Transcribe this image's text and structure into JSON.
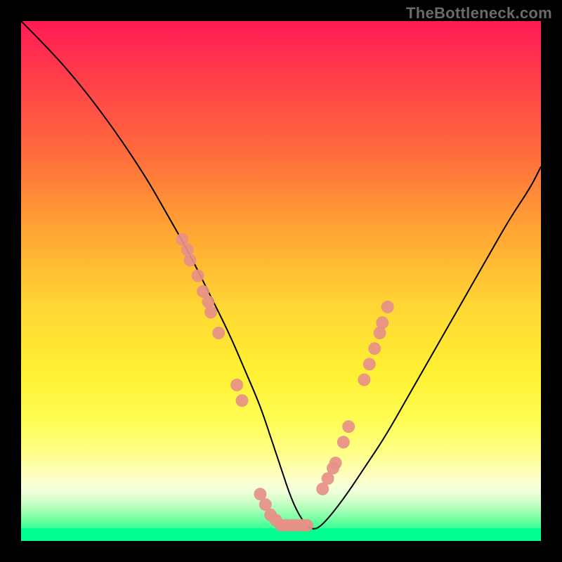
{
  "watermark": "TheBottleneck.com",
  "chart_data": {
    "type": "line",
    "title": "",
    "xlabel": "",
    "ylabel": "",
    "xlim": [
      0,
      100
    ],
    "ylim": [
      0,
      100
    ],
    "grid": false,
    "legend_position": "none",
    "curve": {
      "x": [
        0,
        6,
        12,
        18,
        24,
        28,
        32,
        36,
        40,
        43,
        46,
        48,
        50,
        52,
        54,
        56,
        58,
        62,
        66,
        70,
        74,
        78,
        82,
        86,
        90,
        94,
        98,
        100
      ],
      "y": [
        100,
        94,
        87,
        79,
        70,
        63,
        56,
        48,
        40,
        33,
        26,
        20,
        14,
        8,
        4,
        2,
        3,
        8,
        14,
        20,
        27,
        34,
        41,
        48,
        55,
        62,
        68,
        72
      ]
    },
    "markers": {
      "color": "#e79088",
      "radius_px": 9,
      "points_xy": [
        [
          31,
          58
        ],
        [
          32,
          56
        ],
        [
          32.5,
          54
        ],
        [
          34,
          51
        ],
        [
          35,
          48
        ],
        [
          36,
          46
        ],
        [
          36.5,
          44
        ],
        [
          38,
          40
        ],
        [
          41.5,
          30
        ],
        [
          42.5,
          27
        ],
        [
          46,
          9
        ],
        [
          47,
          7
        ],
        [
          48,
          5
        ],
        [
          49,
          4
        ],
        [
          50,
          3
        ],
        [
          51,
          3
        ],
        [
          52,
          3
        ],
        [
          53,
          3
        ],
        [
          54,
          3
        ],
        [
          55,
          3
        ],
        [
          58,
          10
        ],
        [
          59,
          12
        ],
        [
          60,
          14
        ],
        [
          60.5,
          15
        ],
        [
          62,
          19
        ],
        [
          63,
          22
        ],
        [
          66,
          31
        ],
        [
          67,
          34
        ],
        [
          68,
          37
        ],
        [
          69,
          40
        ],
        [
          69.5,
          42
        ],
        [
          70.5,
          45
        ]
      ]
    },
    "background_gradient": {
      "top_color": "#ff1a55",
      "mid_colors": [
        "#ffa433",
        "#fff133"
      ],
      "bottom_color": "#00ff90"
    }
  }
}
